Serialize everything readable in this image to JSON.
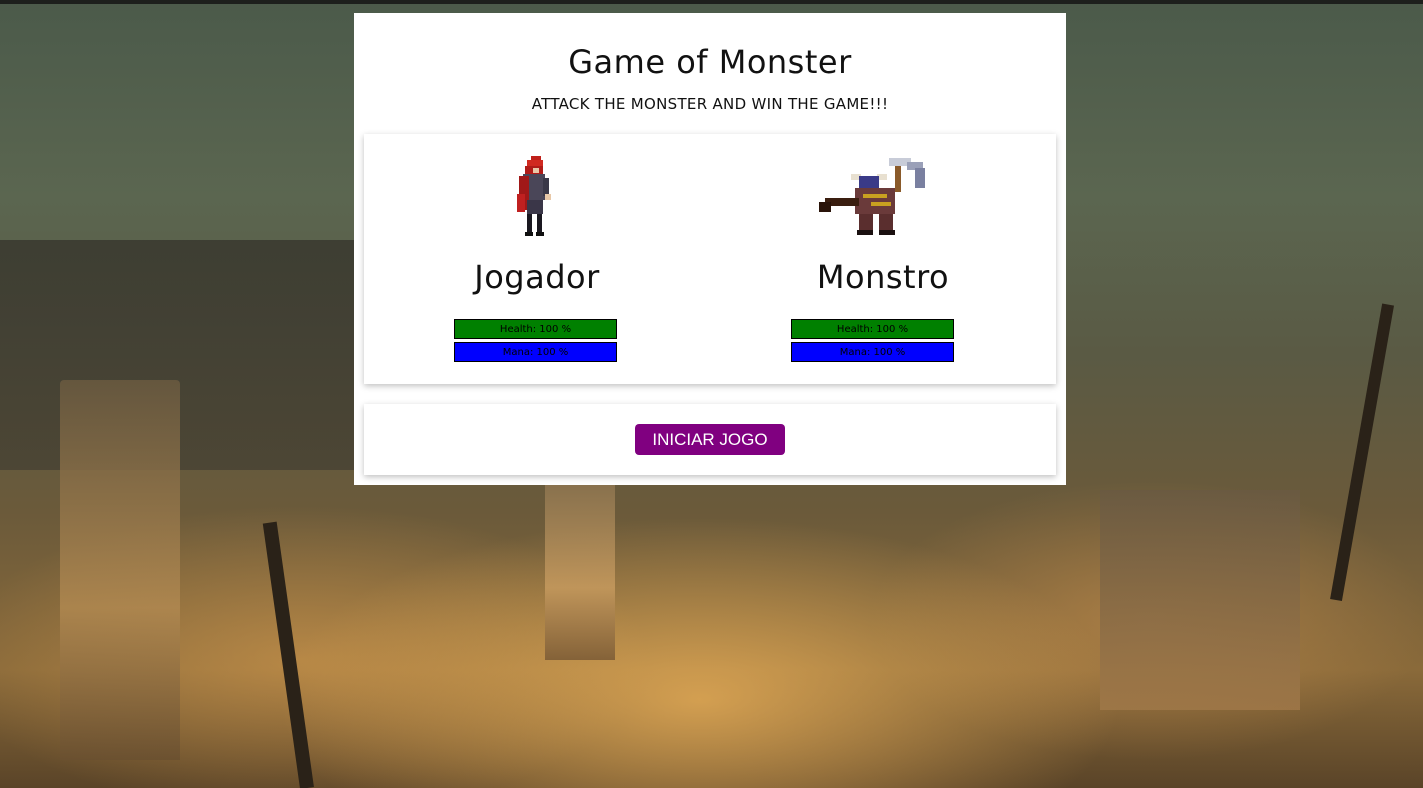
{
  "game": {
    "title": "Game of Monster",
    "subtitle": "ATTACK THE MONSTER AND WIN THE GAME!!!"
  },
  "player": {
    "name": "Jogador",
    "sprite_icon": "red-hooded-warrior-sprite",
    "health_label": "Health: 100 %",
    "health_level": 1.0,
    "mana_label": "Mana: 100 %",
    "mana_level": 1.0
  },
  "monster": {
    "name": "Monstro",
    "sprite_icon": "minotaur-hammer-sprite",
    "health_label": "Health: 100 %",
    "health_level": 1.0,
    "mana_label": "Mana: 100 %",
    "mana_level": 1.0
  },
  "controls": {
    "start_label": "INICIAR JOGO"
  },
  "colors": {
    "health": "#008000",
    "mana": "#0000ff",
    "button": "#800080"
  }
}
